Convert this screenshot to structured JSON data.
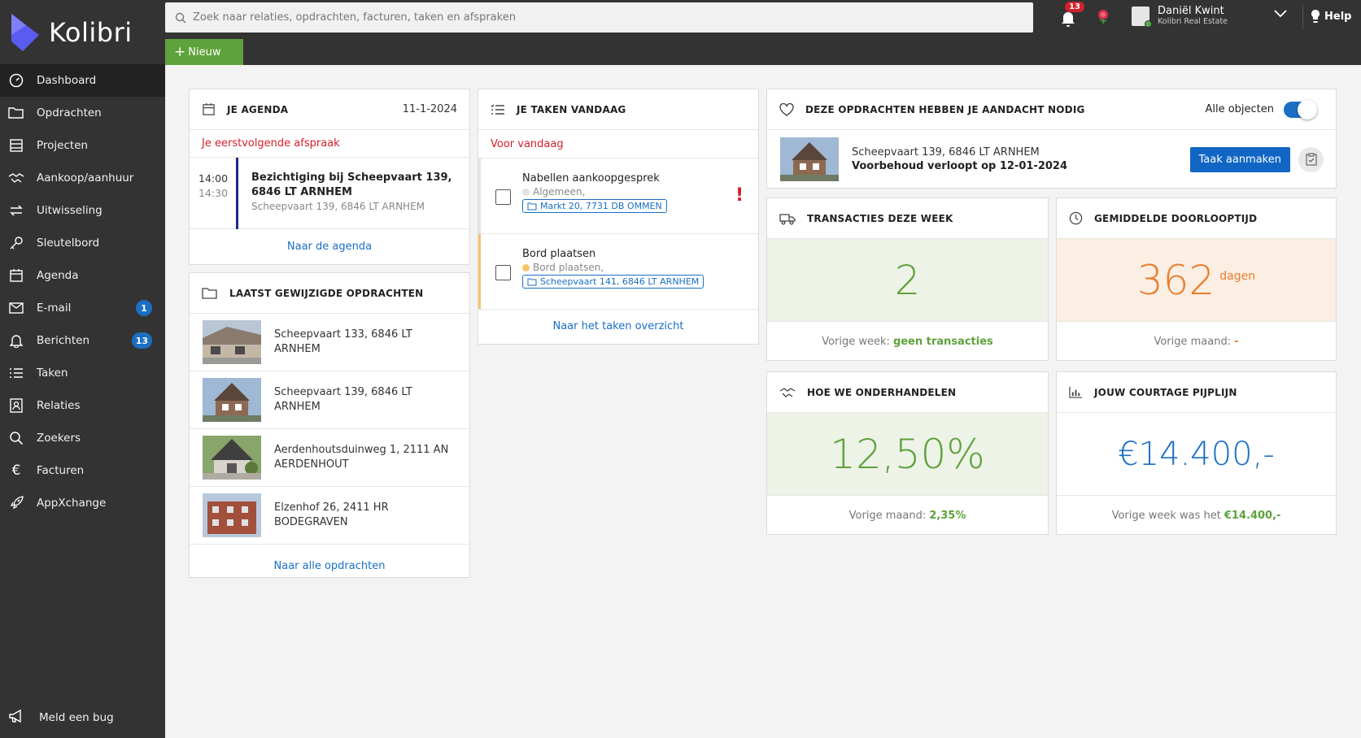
{
  "brand": {
    "name": "Kolibri",
    "accent": "#5a5bf0"
  },
  "search": {
    "placeholder": "Zoek naar relaties, opdrachten, facturen, taken en afspraken"
  },
  "toolbar": {
    "new_label": "Nieuw"
  },
  "notifications": {
    "count": "13"
  },
  "user": {
    "name": "Daniël Kwint",
    "org": "Kolibri Real Estate"
  },
  "help": {
    "label": "Help"
  },
  "sidebar": {
    "items": [
      {
        "label": "Dashboard",
        "icon": "dashboard-icon",
        "active": true
      },
      {
        "label": "Opdrachten",
        "icon": "folder-icon"
      },
      {
        "label": "Projecten",
        "icon": "building-icon"
      },
      {
        "label": "Aankoop/aanhuur",
        "icon": "handshake-icon"
      },
      {
        "label": "Uitwisseling",
        "icon": "exchange-icon"
      },
      {
        "label": "Sleutelbord",
        "icon": "key-icon"
      },
      {
        "label": "Agenda",
        "icon": "calendar-icon"
      },
      {
        "label": "E-mail",
        "icon": "mail-icon",
        "badge": "1"
      },
      {
        "label": "Berichten",
        "icon": "bell-icon",
        "badge": "13"
      },
      {
        "label": "Taken",
        "icon": "tasks-icon"
      },
      {
        "label": "Relaties",
        "icon": "contact-icon"
      },
      {
        "label": "Zoekers",
        "icon": "search-icon"
      },
      {
        "label": "Facturen",
        "icon": "euro-icon"
      },
      {
        "label": "AppXchange",
        "icon": "rocket-icon"
      }
    ],
    "bug_label": "Meld een bug"
  },
  "agenda": {
    "title": "JE AGENDA",
    "date": "11-1-2024",
    "next_label": "Je eerstvolgende afspraak",
    "appointment": {
      "start": "14:00",
      "end": "14:30",
      "title": "Bezichtiging bij Scheepvaart 139, 6846 LT ARNHEM",
      "address": "Scheepvaart 139, 6846 LT ARNHEM"
    },
    "link": "Naar de agenda"
  },
  "opdrachten": {
    "title": "LAATST GEWIJZIGDE OPDRACHTEN",
    "items": [
      {
        "address": "Scheepvaart 133, 6846 LT ARNHEM"
      },
      {
        "address": "Scheepvaart 139, 6846 LT ARNHEM"
      },
      {
        "address": "Aerdenhoutsduinweg 1, 2111 AN AERDENHOUT"
      },
      {
        "address": "Elzenhof 26, 2411 HR BODEGRAVEN"
      }
    ],
    "link": "Naar alle opdrachten"
  },
  "taken": {
    "title": "JE TAKEN VANDAAG",
    "today_label": "Voor vandaag",
    "items": [
      {
        "title": "Nabellen aankoopgesprek",
        "category": "Algemeen,",
        "chip": "Markt 20, 7731 DB OMMEN",
        "urgent": "!"
      },
      {
        "title": "Bord plaatsen",
        "category": "Bord plaatsen,",
        "chip": "Scheepvaart 141, 6846 LT ARNHEM"
      }
    ],
    "link": "Naar het taken overzicht"
  },
  "aandacht": {
    "title": "DEZE OPDRACHTEN HEBBEN JE AANDACHT NODIG",
    "toggle_label": "Alle objecten",
    "address": "Scheepvaart 139, 6846 LT ARNHEM",
    "note": "Voorbehoud verloopt op 12-01-2024",
    "button": "Taak aanmaken"
  },
  "kpi": {
    "transacties": {
      "title": "TRANSACTIES DEZE WEEK",
      "value": "2",
      "foot_label": "Vorige week:",
      "foot_value": "geen transacties"
    },
    "doorloop": {
      "title": "GEMIDDELDE DOORLOOPTIJD",
      "value": "362",
      "unit": "dagen",
      "foot_label": "Vorige maand:",
      "foot_value": "-"
    },
    "onderhandelen": {
      "title": "HOE WE ONDERHANDELEN",
      "value": "12,50%",
      "foot_label": "Vorige maand:",
      "foot_value": "2,35%"
    },
    "courtage": {
      "title": "JOUW COURTAGE PIJPLIJN",
      "value": "€14.400,-",
      "foot_label": "Vorige week was het",
      "foot_value": "€14.400,-"
    }
  }
}
